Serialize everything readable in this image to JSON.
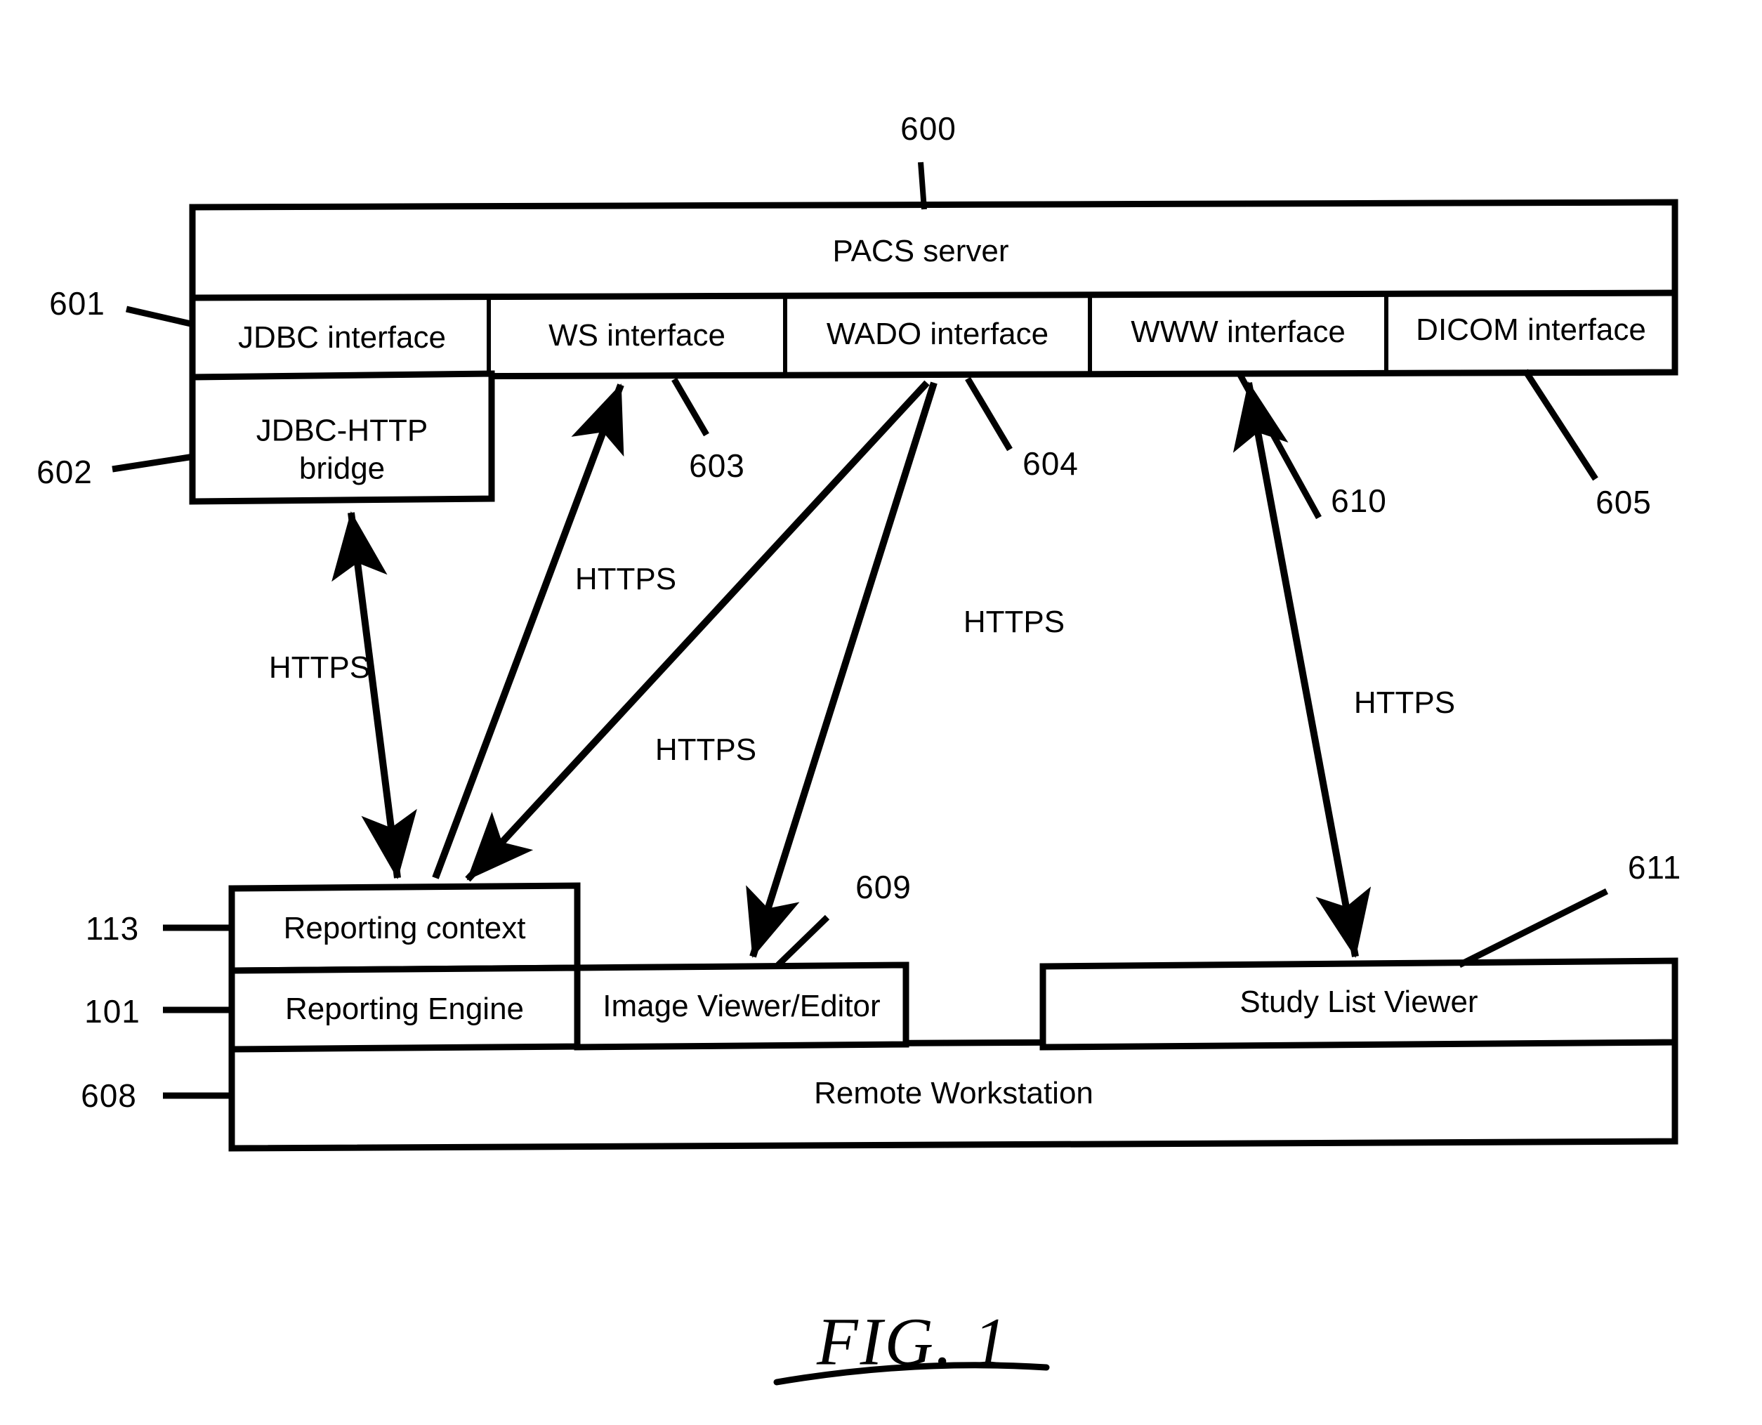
{
  "figure": {
    "caption": "FIG. 1",
    "top_ref": "600"
  },
  "server": {
    "title": "PACS server",
    "ref": "600",
    "interfaces_ref": "601",
    "interfaces": [
      {
        "label": "JDBC interface",
        "ref": "601"
      },
      {
        "label": "WS interface",
        "ref": "603"
      },
      {
        "label": "WADO interface",
        "ref": "604"
      },
      {
        "label": "WWW interface",
        "ref": "610"
      },
      {
        "label": "DICOM interface",
        "ref": "605"
      }
    ],
    "bridge": {
      "label": "JDBC-HTTP\nbridge",
      "ref": "602"
    }
  },
  "workstation": {
    "title": "Remote Workstation",
    "ref": "608",
    "components": [
      {
        "label": "Reporting context",
        "ref": "113"
      },
      {
        "label": "Reporting Engine",
        "ref": "101"
      },
      {
        "label": "Image Viewer/Editor",
        "ref": "609"
      },
      {
        "label": "Study List Viewer",
        "ref": "611"
      }
    ]
  },
  "connections": [
    {
      "protocol": "HTTPS",
      "from": "JDBC-HTTP bridge",
      "to": "Reporting context",
      "arrows": "both"
    },
    {
      "protocol": "HTTPS",
      "from": "Reporting context",
      "to": "WS interface",
      "arrows": "up"
    },
    {
      "protocol": "HTTPS",
      "from": "WADO interface",
      "to": "Reporting context",
      "arrows": "down"
    },
    {
      "protocol": "HTTPS",
      "from": "WADO interface",
      "to": "Image Viewer/Editor",
      "arrows": "down"
    },
    {
      "protocol": "HTTPS",
      "from": "WWW interface",
      "to": "Study List Viewer",
      "arrows": "both"
    }
  ],
  "protocol_labels": [
    {
      "text": "HTTPS",
      "id": "https-jdbc"
    },
    {
      "text": "HTTPS",
      "id": "https-ws"
    },
    {
      "text": "HTTPS",
      "id": "https-wado-context"
    },
    {
      "text": "HTTPS",
      "id": "https-wado-viewer"
    },
    {
      "text": "HTTPS",
      "id": "https-www"
    }
  ],
  "reference_numerals": [
    {
      "value": "600"
    },
    {
      "value": "601"
    },
    {
      "value": "602"
    },
    {
      "value": "603"
    },
    {
      "value": "604"
    },
    {
      "value": "605"
    },
    {
      "value": "608"
    },
    {
      "value": "609"
    },
    {
      "value": "610"
    },
    {
      "value": "611"
    },
    {
      "value": "113"
    },
    {
      "value": "101"
    }
  ],
  "colors": {
    "ink": "#000000",
    "paper": "#ffffff"
  }
}
